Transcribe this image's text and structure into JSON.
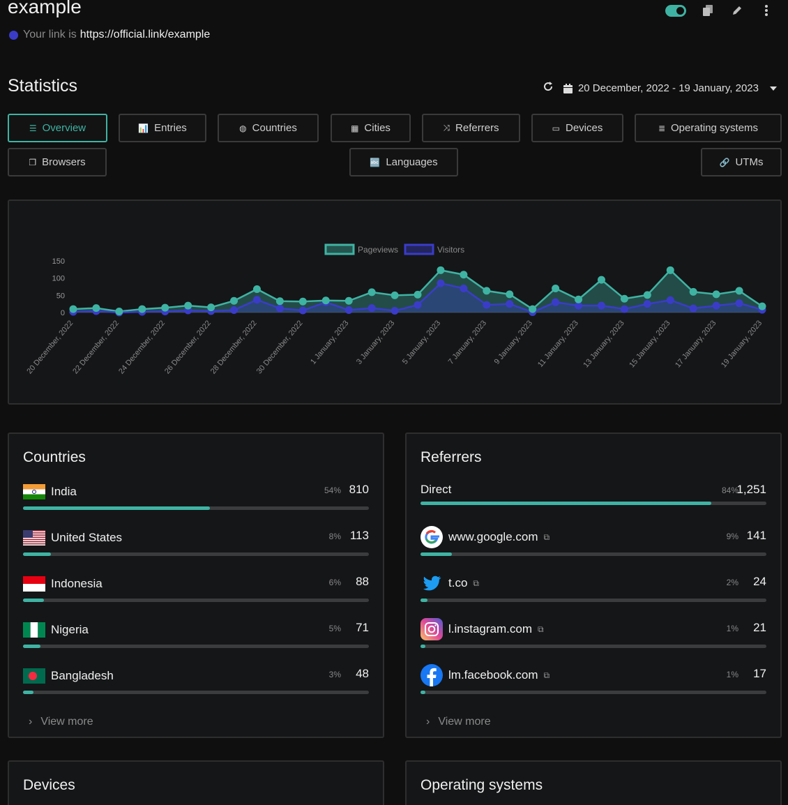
{
  "header": {
    "title": "example",
    "link_prefix": "Your link is",
    "link_url": "https://official.link/example",
    "icons": [
      "toggle-switch",
      "copy-icon",
      "pencil-icon",
      "kebab-menu-icon"
    ]
  },
  "stats": {
    "title": "Statistics",
    "date_range": "20 December, 2022 - 19 January, 2023"
  },
  "tabs": [
    {
      "label": "Overview",
      "icon": "list-icon",
      "active": true
    },
    {
      "label": "Entries",
      "icon": "bar-chart-icon"
    },
    {
      "label": "Countries",
      "icon": "globe-icon"
    },
    {
      "label": "Cities",
      "icon": "city-icon"
    },
    {
      "label": "Referrers",
      "icon": "shuffle-icon"
    },
    {
      "label": "Devices",
      "icon": "laptop-icon"
    },
    {
      "label": "Operating systems",
      "icon": "server-icon"
    },
    {
      "label": "Browsers",
      "icon": "windows-icon"
    },
    {
      "label": "Languages",
      "icon": "language-icon"
    },
    {
      "label": "UTMs",
      "icon": "link-icon"
    }
  ],
  "chart_data": {
    "type": "area",
    "x": [
      "20 December, 2022",
      "21 December, 2022",
      "22 December, 2022",
      "23 December, 2022",
      "24 December, 2022",
      "25 December, 2022",
      "26 December, 2022",
      "27 December, 2022",
      "28 December, 2022",
      "29 December, 2022",
      "30 December, 2022",
      "31 December, 2022",
      "1 January, 2023",
      "2 January, 2023",
      "3 January, 2023",
      "4 January, 2023",
      "5 January, 2023",
      "6 January, 2023",
      "7 January, 2023",
      "8 January, 2023",
      "9 January, 2023",
      "10 January, 2023",
      "11 January, 2023",
      "12 January, 2023",
      "13 January, 2023",
      "14 January, 2023",
      "15 January, 2023",
      "16 January, 2023",
      "17 January, 2023",
      "18 January, 2023",
      "19 January, 2023"
    ],
    "tick_labels": [
      "20 December, 2022",
      "22 December, 2022",
      "24 December, 2022",
      "26 December, 2022",
      "28 December, 2022",
      "30 December, 2022",
      "1 January, 2023",
      "3 January, 2023",
      "5 January, 2023",
      "7 January, 2023",
      "9 January, 2023",
      "11 January, 2023",
      "13 January, 2023",
      "15 January, 2023",
      "17 January, 2023",
      "19 January, 2023"
    ],
    "series": [
      {
        "name": "Pageviews",
        "color": "#3fb3a3",
        "values": [
          10,
          13,
          3,
          10,
          14,
          20,
          15,
          34,
          68,
          33,
          32,
          35,
          34,
          59,
          50,
          52,
          123,
          110,
          63,
          53,
          10,
          70,
          38,
          95,
          40,
          51,
          123,
          60,
          53,
          63,
          18
        ]
      },
      {
        "name": "Visitors",
        "color": "#3a3cc8",
        "values": [
          2,
          4,
          0,
          2,
          3,
          6,
          4,
          7,
          37,
          12,
          6,
          30,
          7,
          13,
          5,
          22,
          85,
          70,
          22,
          25,
          1,
          30,
          20,
          20,
          10,
          25,
          36,
          12,
          20,
          27,
          8
        ]
      }
    ],
    "yticks": [
      0,
      50,
      100,
      150
    ],
    "ylim": [
      0,
      150
    ],
    "legend": "top-center"
  },
  "countries": {
    "title": "Countries",
    "rows": [
      {
        "name": "India",
        "pct": "54%",
        "value": "810",
        "fill": 0.54,
        "flag": "india"
      },
      {
        "name": "United States",
        "pct": "8%",
        "value": "113",
        "fill": 0.08,
        "flag": "us"
      },
      {
        "name": "Indonesia",
        "pct": "6%",
        "value": "88",
        "fill": 0.06,
        "flag": "indonesia"
      },
      {
        "name": "Nigeria",
        "pct": "5%",
        "value": "71",
        "fill": 0.05,
        "flag": "nigeria"
      },
      {
        "name": "Bangladesh",
        "pct": "3%",
        "value": "48",
        "fill": 0.03,
        "flag": "bangladesh"
      }
    ],
    "view_more": "View more"
  },
  "referrers": {
    "title": "Referrers",
    "rows": [
      {
        "name": "Direct",
        "pct": "84%",
        "value": "1,251",
        "fill": 0.84,
        "icon": ""
      },
      {
        "name": "www.google.com",
        "pct": "9%",
        "value": "141",
        "fill": 0.09,
        "icon": "google-icon"
      },
      {
        "name": "t.co",
        "pct": "2%",
        "value": "24",
        "fill": 0.02,
        "icon": "twitter-icon"
      },
      {
        "name": "l.instagram.com",
        "pct": "1%",
        "value": "21",
        "fill": 0.01,
        "icon": "instagram-icon"
      },
      {
        "name": "lm.facebook.com",
        "pct": "1%",
        "value": "17",
        "fill": 0.01,
        "icon": "facebook-icon"
      }
    ],
    "view_more": "View more"
  },
  "devices": {
    "title": "Devices"
  },
  "os": {
    "title": "Operating systems"
  }
}
